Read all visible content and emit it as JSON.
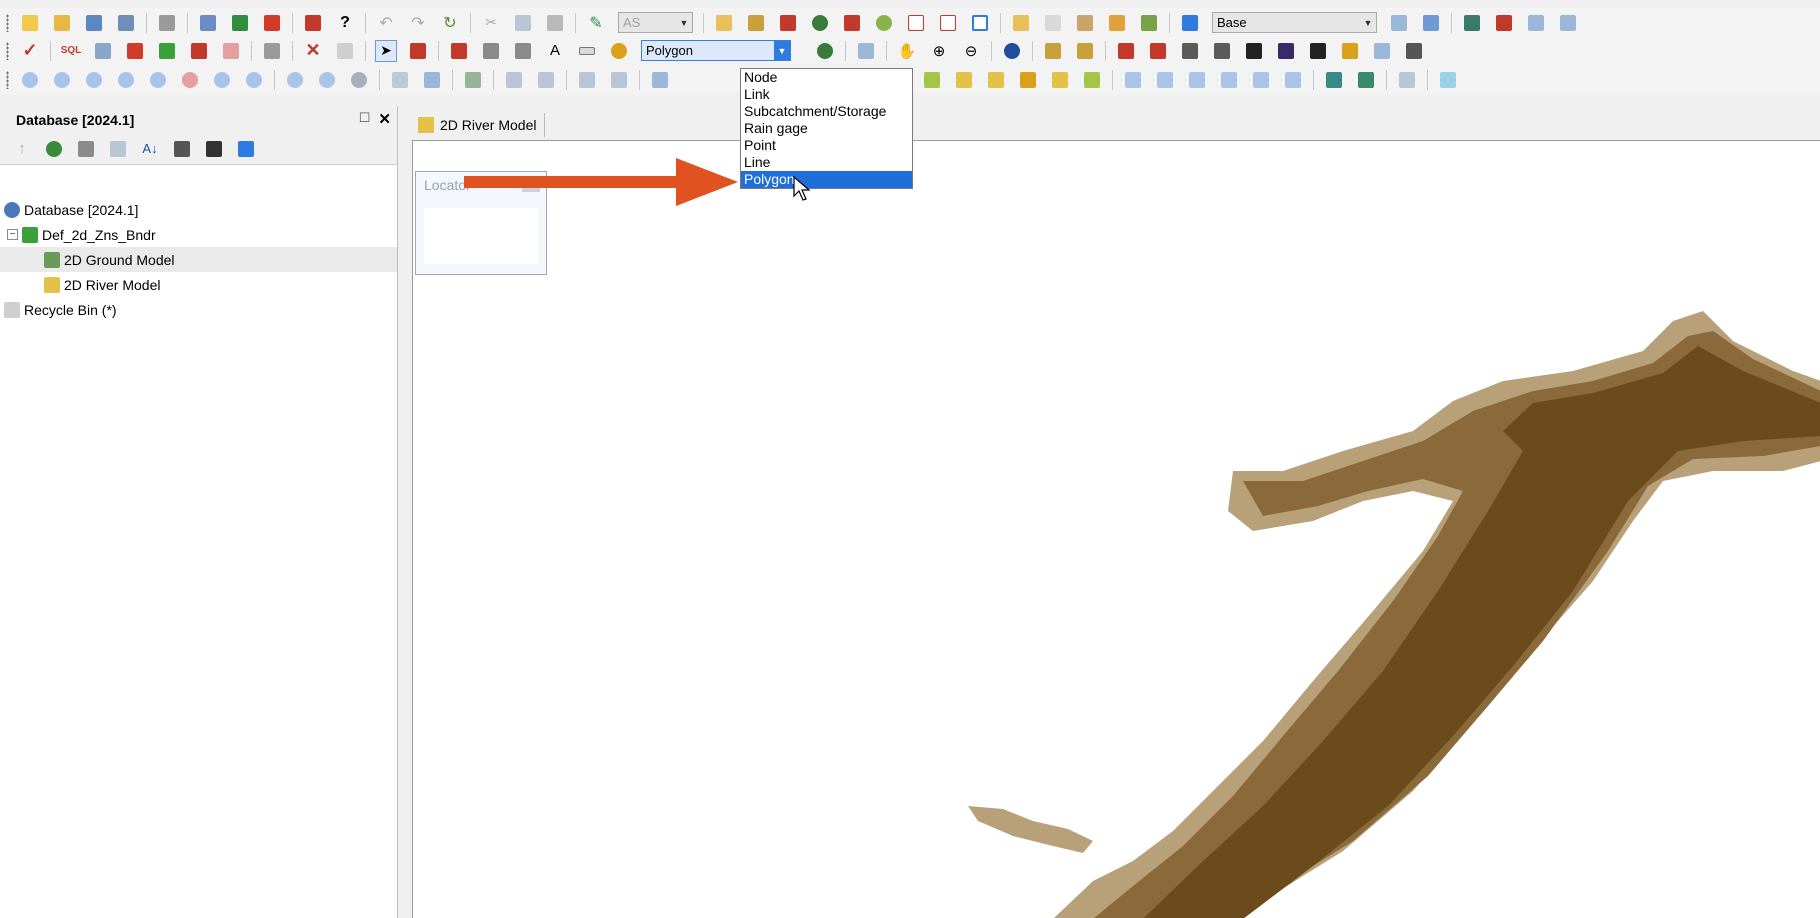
{
  "toolbar1": {
    "scenario_combo": "AS",
    "network_combo": "Base"
  },
  "toolbar2": {
    "object_type_combo": "Polygon"
  },
  "object_type_dropdown": {
    "options": [
      "Node",
      "Link",
      "Subcatchment/Storage",
      "Rain gage",
      "Point",
      "Line",
      "Polygon"
    ],
    "selected": "Polygon"
  },
  "left_panel": {
    "title": "Database [2024.1]",
    "tree": [
      {
        "label": "Database [2024.1]",
        "icon": "database-icon",
        "level": 0
      },
      {
        "label": "Def_2d_Zns_Bndr",
        "icon": "model-group-icon",
        "level": 1,
        "expander": "−"
      },
      {
        "label": "2D Ground Model",
        "icon": "ground-model-icon",
        "level": 2
      },
      {
        "label": "2D River Model",
        "icon": "river-model-icon",
        "level": 2
      },
      {
        "label": "Recycle Bin (*)",
        "icon": "recycle-bin-icon",
        "level": 0
      }
    ]
  },
  "document": {
    "tab_label": "2D River Model",
    "locator_title": "Locator"
  },
  "colors": {
    "dropdown_selection": "#1e6fd9",
    "annotation_arrow": "#e0521f",
    "river_dark": "#6b4a1c",
    "river_mid": "#8a6a3a",
    "river_light": "#b8a078"
  }
}
